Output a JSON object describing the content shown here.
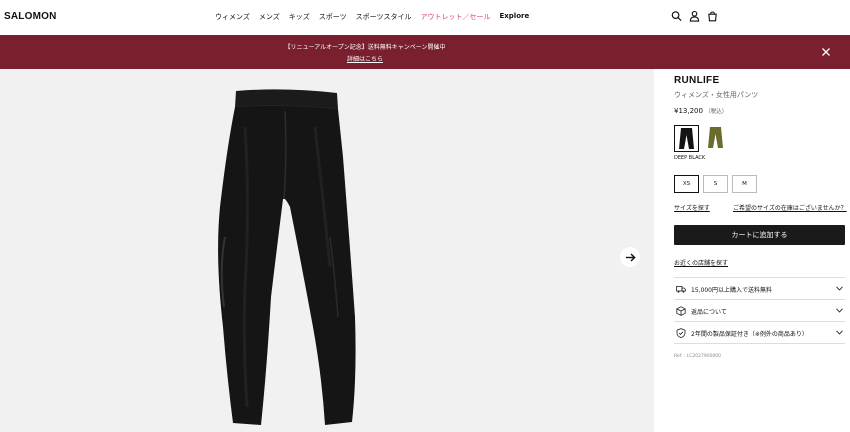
{
  "header": {
    "logo": "SALOMON",
    "nav": [
      "ウィメンズ",
      "メンズ",
      "キッズ",
      "スポーツ",
      "スポーツスタイル"
    ],
    "outlet": "アウトレット／セール",
    "explore": "Explore",
    "icons": [
      "search-icon",
      "account-icon",
      "cart-icon"
    ]
  },
  "banner": {
    "text": "【リニューアルオープン記念】送料無料キャンペーン開催中",
    "link": "詳細はこちら",
    "bg": "#7a1f2d"
  },
  "product": {
    "title": "RUNLIFE",
    "subtitle": "ウィメンズ・女性用パンツ",
    "price": "¥13,200",
    "tax": "（税込）",
    "color_name": "DEEP BLACK",
    "sizes": [
      "XS",
      "S",
      "M"
    ],
    "selected_size": "XS",
    "find_size": "サイズを探す",
    "stock_query": "ご希望のサイズの在庫はございませんか？",
    "add_to_cart": "カートに追加する",
    "nearby_store": "お近くの店舗を探す",
    "accordion": [
      {
        "icon": "truck-icon",
        "label": "15,000円以上購入で送料無料"
      },
      {
        "icon": "box-icon",
        "label": "返品について"
      },
      {
        "icon": "shield-icon",
        "label": "2年間の製品保証付き（※例外の商品あり）"
      }
    ],
    "ref": "Ref. : LC2027900000"
  }
}
